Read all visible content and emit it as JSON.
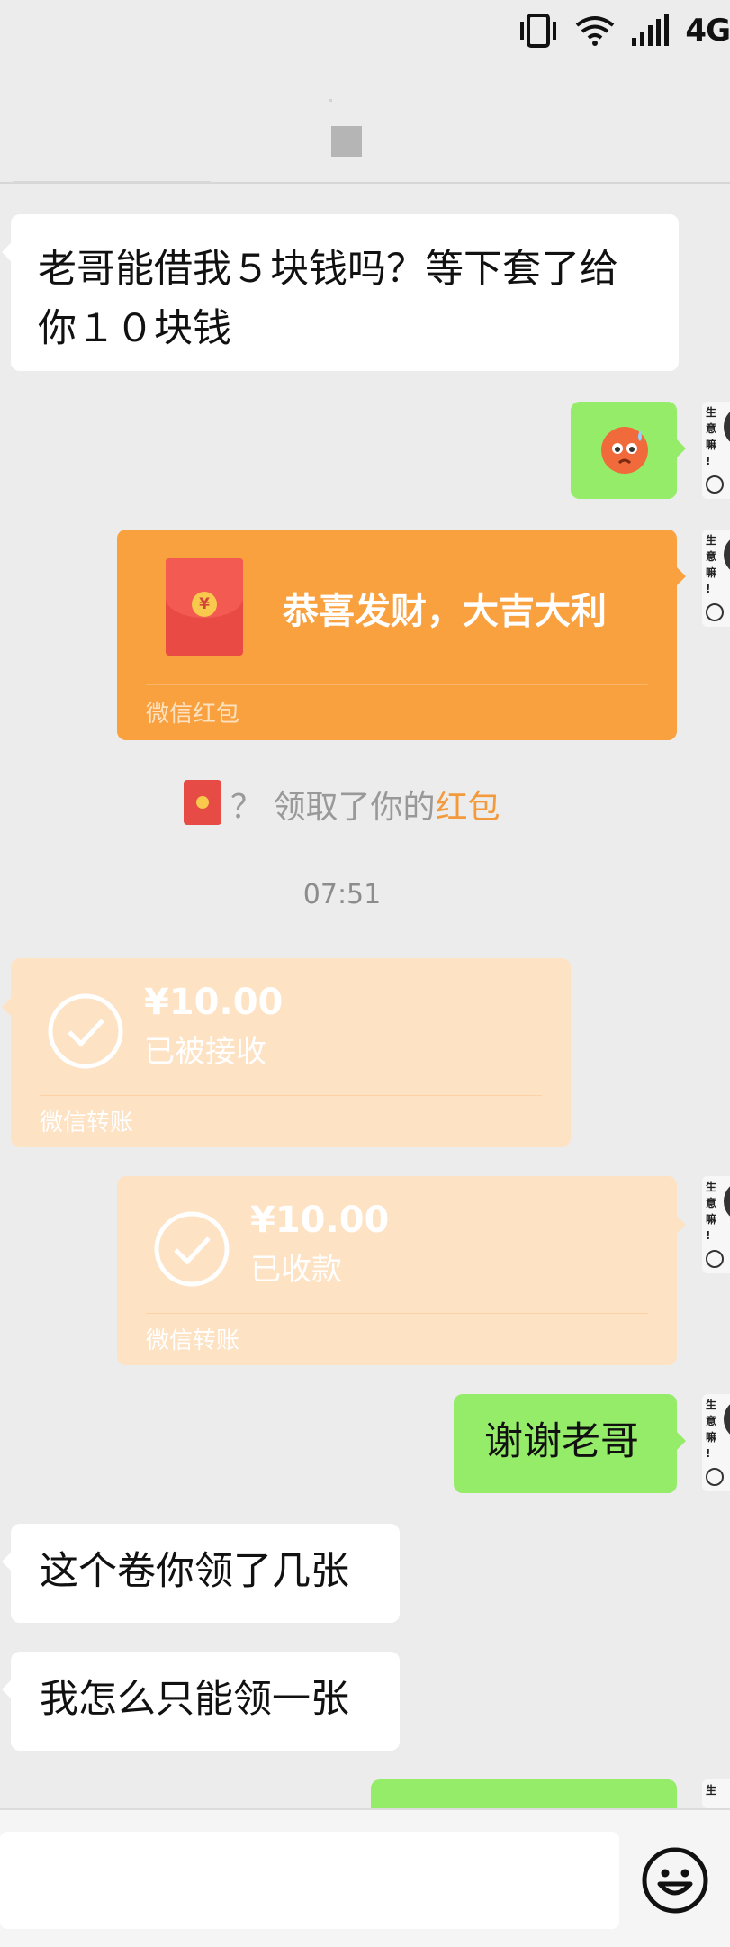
{
  "status_bar": {
    "network": "4G",
    "icons": [
      "vibrate-icon",
      "wifi-icon",
      "signal-icon"
    ]
  },
  "chat": {
    "messages": [
      {
        "type": "text",
        "side": "left",
        "text_line1": "老哥能借我５块钱吗？等下套了给",
        "text_line2": "你１０块钱"
      },
      {
        "type": "emoji",
        "side": "right",
        "icon": "sweat-emoji-icon"
      },
      {
        "type": "red_packet",
        "side": "right",
        "title": "恭喜发财，大吉大利",
        "footer": "微信红包"
      },
      {
        "type": "system",
        "prefix": "？ 领取了你的",
        "highlight": "红包"
      },
      {
        "type": "time",
        "text": "07:51"
      },
      {
        "type": "transfer",
        "side": "left",
        "amount": "¥10.00",
        "status": "已被接收",
        "footer": "微信转账"
      },
      {
        "type": "transfer",
        "side": "right",
        "amount": "¥10.00",
        "status": "已收款",
        "footer": "微信转账"
      },
      {
        "type": "text",
        "side": "right",
        "text": "谢谢老哥"
      },
      {
        "type": "text",
        "side": "left",
        "text": "这个卷你领了几张"
      },
      {
        "type": "text",
        "side": "left",
        "text": "我怎么只能领一张"
      }
    ]
  },
  "avatar_text": "生意嘛！",
  "input_bar": {
    "placeholder": "",
    "emoji_icon": "smiley-icon"
  },
  "colors": {
    "background": "#ececec",
    "self_bubble": "#95ec69",
    "red_packet": "#f9a03f",
    "transfer": "#fde2c4",
    "highlight": "#f39a3c"
  }
}
